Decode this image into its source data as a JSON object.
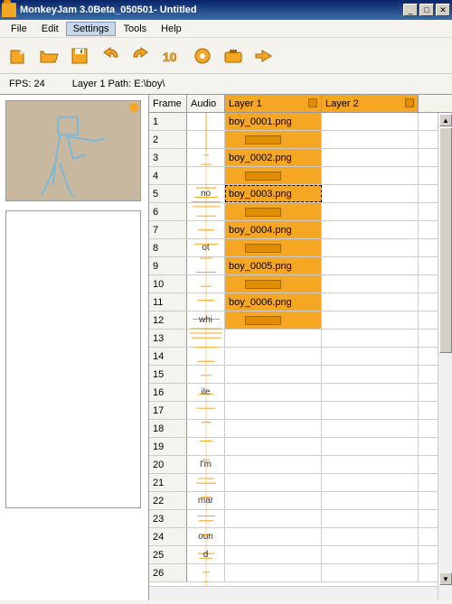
{
  "window": {
    "title": "MonkeyJam 3.0Beta_050501- Untitled"
  },
  "menu": {
    "file": "File",
    "edit": "Edit",
    "settings": "Settings",
    "tools": "Tools",
    "help": "Help"
  },
  "info": {
    "fps_label": "FPS: 24",
    "path_label": "Layer 1 Path: E:\\boy\\"
  },
  "headers": {
    "frame": "Frame",
    "audio": "Audio",
    "layer1": "Layer 1",
    "layer2": "Layer 2"
  },
  "rows": [
    {
      "n": "1",
      "audio": "",
      "l1": "boy_0001.png",
      "l1type": "text"
    },
    {
      "n": "2",
      "audio": "",
      "l1": "",
      "l1type": "bar"
    },
    {
      "n": "3",
      "audio": "",
      "l1": "boy_0002.png",
      "l1type": "text"
    },
    {
      "n": "4",
      "audio": "",
      "l1": "",
      "l1type": "bar"
    },
    {
      "n": "5",
      "audio": "no",
      "l1": "boy_0003.png",
      "l1type": "sel"
    },
    {
      "n": "6",
      "audio": "",
      "l1": "",
      "l1type": "bar"
    },
    {
      "n": "7",
      "audio": "",
      "l1": "boy_0004.png",
      "l1type": "text"
    },
    {
      "n": "8",
      "audio": "ot",
      "l1": "",
      "l1type": "bar"
    },
    {
      "n": "9",
      "audio": "",
      "l1": "boy_0005.png",
      "l1type": "text"
    },
    {
      "n": "10",
      "audio": "",
      "l1": "",
      "l1type": "bar"
    },
    {
      "n": "11",
      "audio": "",
      "l1": "boy_0006.png",
      "l1type": "text"
    },
    {
      "n": "12",
      "audio": "whi",
      "l1": "",
      "l1type": "bar"
    },
    {
      "n": "13",
      "audio": "",
      "l1": "",
      "l1type": ""
    },
    {
      "n": "14",
      "audio": "",
      "l1": "",
      "l1type": ""
    },
    {
      "n": "15",
      "audio": "",
      "l1": "",
      "l1type": ""
    },
    {
      "n": "16",
      "audio": "ile",
      "l1": "",
      "l1type": ""
    },
    {
      "n": "17",
      "audio": "",
      "l1": "",
      "l1type": ""
    },
    {
      "n": "18",
      "audio": "",
      "l1": "",
      "l1type": ""
    },
    {
      "n": "19",
      "audio": "",
      "l1": "",
      "l1type": ""
    },
    {
      "n": "20",
      "audio": "I'm",
      "l1": "",
      "l1type": ""
    },
    {
      "n": "21",
      "audio": "",
      "l1": "",
      "l1type": ""
    },
    {
      "n": "22",
      "audio": "mar",
      "l1": "",
      "l1type": ""
    },
    {
      "n": "23",
      "audio": "",
      "l1": "",
      "l1type": ""
    },
    {
      "n": "24",
      "audio": "oun",
      "l1": "",
      "l1type": ""
    },
    {
      "n": "25",
      "audio": "d",
      "l1": "",
      "l1type": ""
    },
    {
      "n": "26",
      "audio": "",
      "l1": "",
      "l1type": ""
    }
  ]
}
